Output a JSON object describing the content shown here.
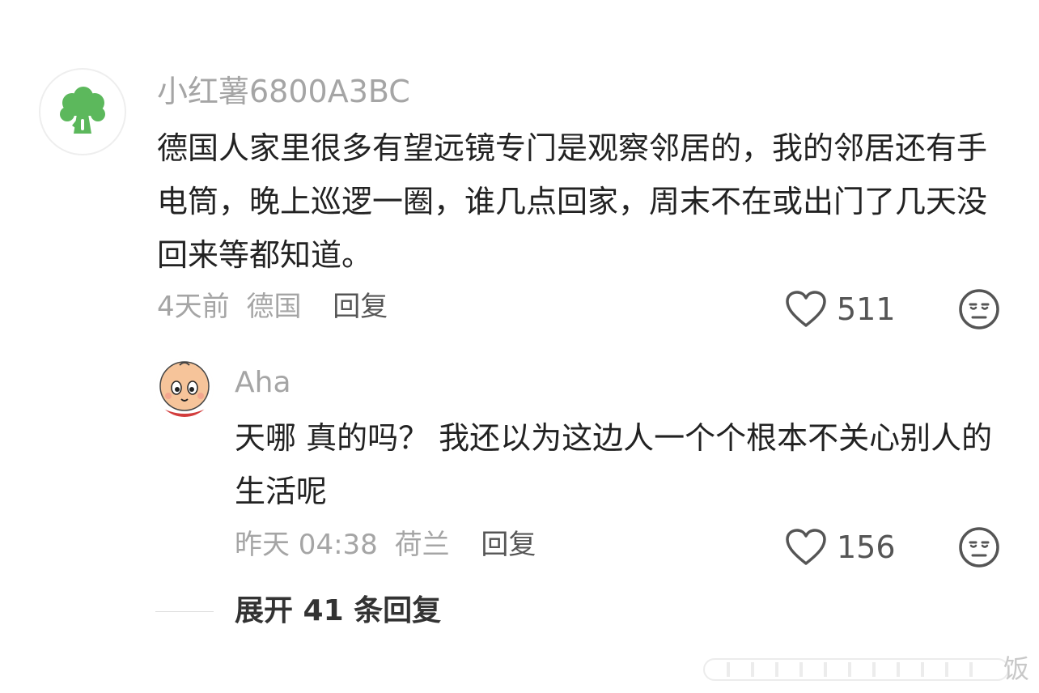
{
  "comment": {
    "username": "小红薯6800A3BC",
    "avatar_icon": "broccoli-icon",
    "content": "德国人家里很多有望远镜专门是观察邻居的，我的邻居还有手电筒，晚上巡逻一圈，谁几点回家，周末不在或出门了几天没回来等都知道。",
    "time": "4天前",
    "location": "德国",
    "reply_label": "回复",
    "likes": "511",
    "colors": {
      "avatar_green": "#5cb85c",
      "meta_gray": "#a5a5a5"
    }
  },
  "reply": {
    "username": "Aha",
    "avatar_icon": "cartoon-face-avatar",
    "content": "天哪 真的吗？ 我还以为这边人一个个根本不关心别人的生活呢",
    "time": "昨天 04:38",
    "location": "荷兰",
    "reply_label": "回复",
    "likes": "156"
  },
  "expand": {
    "label": "展开 41 条回复"
  },
  "watermark": {
    "char": "饭"
  }
}
